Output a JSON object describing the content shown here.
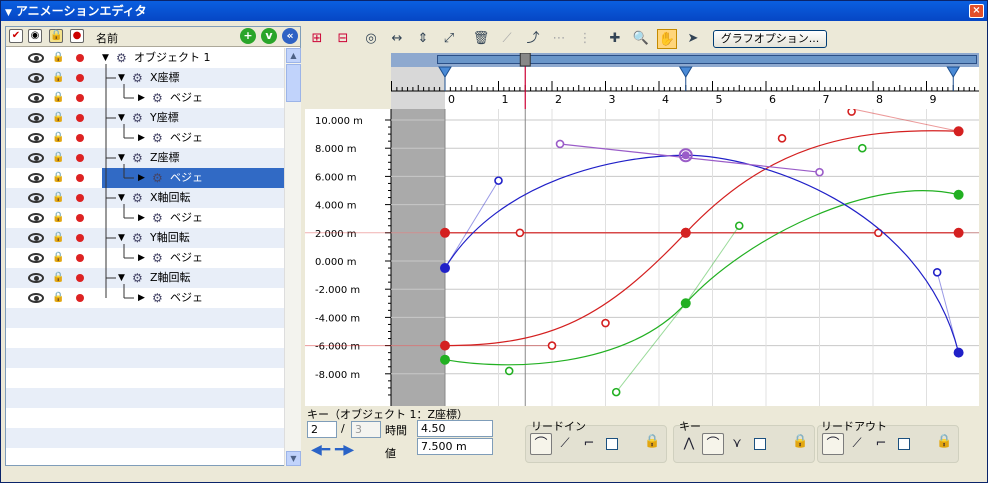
{
  "window": {
    "title": "アニメーションエディタ",
    "close_label": "×"
  },
  "layers": {
    "header_name": "名前",
    "add_label": "+",
    "down_label": "v",
    "collapse_label": "«",
    "rows": [
      {
        "label": "オブジェクト 1",
        "selected": false
      },
      {
        "label": "X座標",
        "selected": false
      },
      {
        "label": "ベジェ",
        "selected": false
      },
      {
        "label": "Y座標",
        "selected": false
      },
      {
        "label": "ベジェ",
        "selected": false
      },
      {
        "label": "Z座標",
        "selected": false
      },
      {
        "label": "ベジェ",
        "selected": true
      },
      {
        "label": "X軸回転",
        "selected": false
      },
      {
        "label": "ベジェ",
        "selected": false
      },
      {
        "label": "Y軸回転",
        "selected": false
      },
      {
        "label": "ベジェ",
        "selected": false
      },
      {
        "label": "Z軸回転",
        "selected": false
      },
      {
        "label": "ベジェ",
        "selected": false
      }
    ]
  },
  "toolbar": {
    "graph_options_label": "グラフオプション..."
  },
  "timeline": {
    "ticks": [
      "0",
      "1",
      "2",
      "3",
      "4",
      "5",
      "6",
      "7",
      "8",
      "9"
    ]
  },
  "graph": {
    "y_labels": [
      "10.000 m",
      "8.000 m",
      "6.000 m",
      "4.000 m",
      "2.000 m",
      "0.000 m",
      "-2.000 m",
      "-4.000 m",
      "-6.000 m",
      "-8.000 m"
    ],
    "colors": {
      "red": "#d42020",
      "green": "#22b022",
      "blue": "#2020c8",
      "purple": "#9a5cc8"
    }
  },
  "key_panel": {
    "title": "キー（オブジェクト 1：Z座標）",
    "index_value": "2",
    "slash": "/",
    "count_value": "3",
    "time_label": "時間",
    "time_value": "4.50",
    "value_label": "値",
    "value_value": "7.500 m"
  },
  "groups": {
    "lead_in": "リードイン",
    "key": "キー",
    "lead_out": "リードアウト"
  }
}
